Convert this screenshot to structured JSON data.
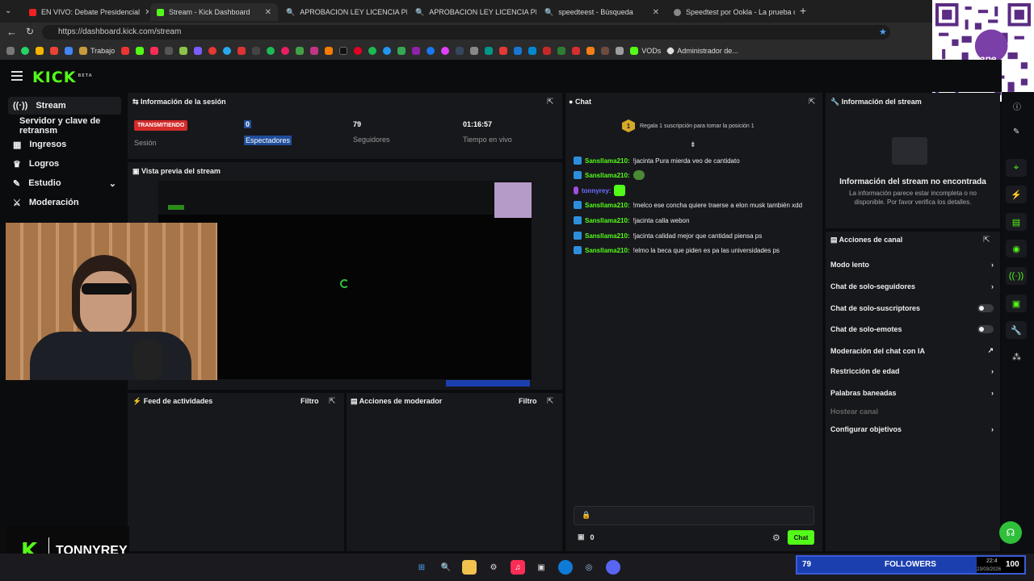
{
  "tabs": [
    {
      "label": "EN VIVO: Debate Presidencial"
    },
    {
      "label": "Stream - Kick Dashboard"
    },
    {
      "label": "APROBACION LEY LICENCIA PERM"
    },
    {
      "label": "APROBACION LEY LICENCIA PERM"
    },
    {
      "label": "speedteest - Búsqueda"
    },
    {
      "label": "Speedtest por Ookla - La prueba d"
    }
  ],
  "address": {
    "url": "https://dashboard.kick.com/stream"
  },
  "bookmarks": {
    "work": "Trabajo",
    "vods": "VODs",
    "admin": "Administrador de..."
  },
  "header": {
    "logo": "KICK",
    "beta": "BETA"
  },
  "sidebar": {
    "items": [
      {
        "label": "Stream"
      },
      {
        "label": "Servidor y clave de retransm"
      },
      {
        "label": "Ingresos"
      },
      {
        "label": "Logros"
      },
      {
        "label": "Estudio"
      },
      {
        "label": "Moderación"
      }
    ]
  },
  "session": {
    "title": "Información de la sesión",
    "status": "TRANSMITIENDO",
    "status_label": "Sesión",
    "viewers": "0",
    "viewers_label": "Espectadores",
    "followers": "79",
    "followers_label": "Seguidores",
    "uptime": "01:16:57",
    "uptime_label": "Tiempo en vivo"
  },
  "preview": {
    "title": "Vista previa del stream"
  },
  "activity": {
    "title": "Feed de actividades",
    "filter": "Filtro"
  },
  "modactions": {
    "title": "Acciones de moderador",
    "filter": "Filtro"
  },
  "chat": {
    "title": "Chat",
    "gift_rank": "1",
    "gift_text": "Regala 1 suscripción para tomar la posición 1",
    "messages": [
      {
        "user": "Sansllama210:",
        "text": "!jacinta Pura mierda veo de cantidato"
      },
      {
        "user": "Sansllama210:",
        "text": ""
      },
      {
        "user": "tonnyrey:",
        "text": ""
      },
      {
        "user": "Sansllama210:",
        "text": "!melco ese concha quiere traerse a elon musk también xdd"
      },
      {
        "user": "Sansllama210:",
        "text": "!jacinta calla webon"
      },
      {
        "user": "Sansllama210:",
        "text": "!jacinta calidad mejor que cantidad piensa ps"
      },
      {
        "user": "Sansllama210:",
        "text": "!elmo la beca que piden es pa las universidades ps"
      }
    ],
    "count": "0",
    "send": "Chat"
  },
  "streaminfo": {
    "title": "Información del stream",
    "empty_title": "Información del stream no encontrada",
    "empty_text": "La información parece estar incompleta o no disponible. Por favor verifica los detalles."
  },
  "channel_actions": {
    "title": "Acciones de canal",
    "items": [
      {
        "label": "Modo lento"
      },
      {
        "label": "Chat de solo-seguidores"
      },
      {
        "label": "Chat de solo-suscriptores"
      },
      {
        "label": "Chat de solo-emotes"
      },
      {
        "label": "Moderación del chat con IA"
      },
      {
        "label": "Restricción de edad"
      },
      {
        "label": "Palabras baneadas"
      },
      {
        "label": "Hostear canal"
      },
      {
        "label": "Configurar objetivos"
      }
    ]
  },
  "overlay": {
    "channel": "TONNYREY",
    "followers_count": "79",
    "followers_label": "FOLLOWERS",
    "goal": "100",
    "clock": "22:4",
    "date": "23/03/2026",
    "qr_brand": "yape"
  },
  "colors": {
    "accent": "#53fc18",
    "live": "#d42a2a",
    "overlay_blue": "#1c3fb0"
  }
}
